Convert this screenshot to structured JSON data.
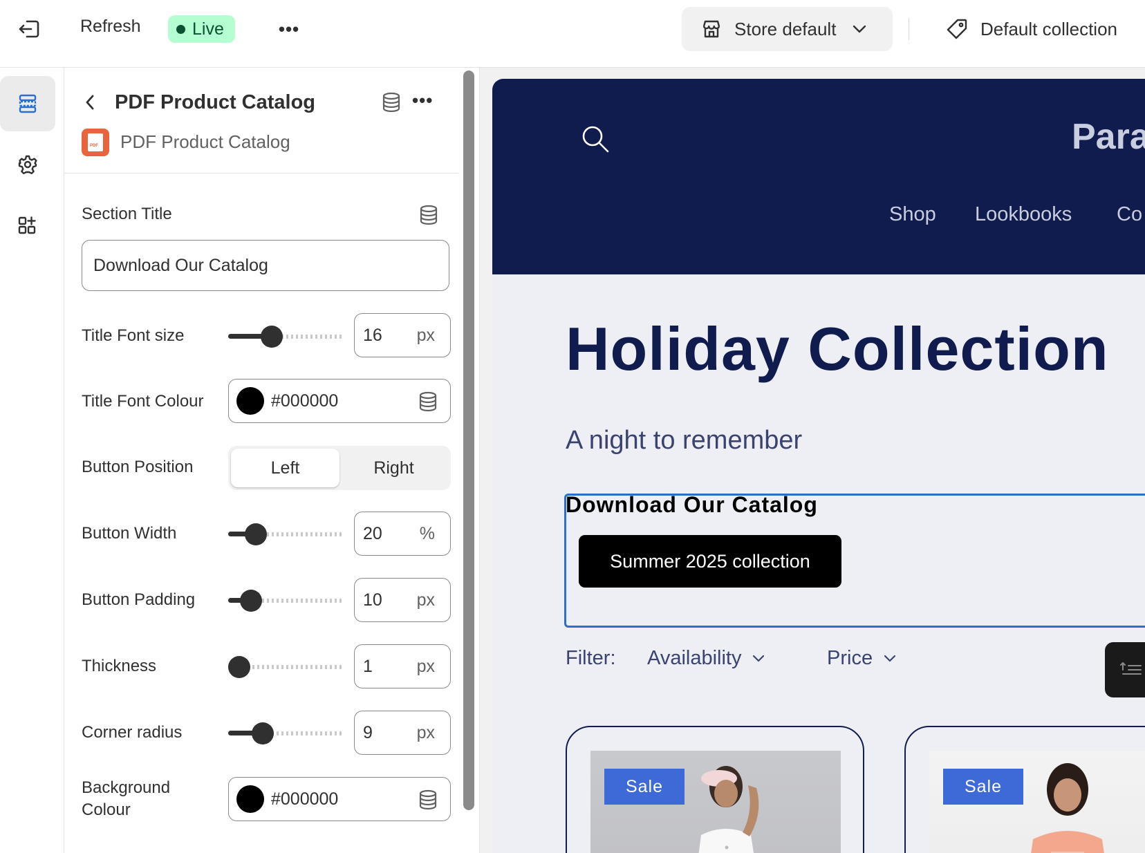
{
  "topbar": {
    "exit_icon": "exit-icon",
    "refresh_label": "Refresh",
    "live_label": "Live",
    "more_label": "•••",
    "store_select_label": "Store default",
    "collection_label": "Default collection"
  },
  "rail": {
    "items": [
      {
        "name": "sections-icon",
        "active": true
      },
      {
        "name": "settings-icon",
        "active": false
      },
      {
        "name": "apps-icon",
        "active": false
      }
    ]
  },
  "panel": {
    "title": "PDF Product Catalog",
    "more_label": "•••",
    "app_name": "PDF Product Catalog",
    "app_icon_text": "PDF",
    "section_title_label": "Section Title",
    "section_title_value": "Download Our Catalog",
    "title_font_size": {
      "label": "Title Font size",
      "value": "16",
      "unit": "px",
      "fraction": 0.35
    },
    "title_font_colour": {
      "label": "Title Font Colour",
      "value": "#000000"
    },
    "button_position": {
      "label": "Button Position",
      "options": [
        "Left",
        "Right"
      ],
      "selected": "Left"
    },
    "button_width": {
      "label": "Button Width",
      "value": "20",
      "unit": "%",
      "fraction": 0.18
    },
    "button_padding": {
      "label": "Button Padding",
      "value": "10",
      "unit": "px",
      "fraction": 0.13
    },
    "thickness": {
      "label": "Thickness",
      "value": "1",
      "unit": "px",
      "fraction": 0.0
    },
    "corner_radius": {
      "label": "Corner radius",
      "value": "9",
      "unit": "px",
      "fraction": 0.25
    },
    "background_colour": {
      "label_line1": "Background",
      "label_line2": "Colour",
      "value": "#000000"
    }
  },
  "preview": {
    "store_logo": "Para",
    "nav": [
      "Shop",
      "Lookbooks",
      "Co"
    ],
    "hero_title": "Holiday Collection",
    "hero_subtitle": "A night to remember",
    "catalog_title": "Download Our Catalog",
    "catalog_button": "Summer 2025 collection",
    "filter_label": "Filter:",
    "filters": [
      "Availability",
      "Price"
    ],
    "sale_badge": "Sale"
  },
  "colors": {
    "header_navy": "#111c4e",
    "live_bg": "#b4fed2",
    "sale_blue": "#3d6ad6",
    "selection_blue": "#2c6ecb"
  }
}
